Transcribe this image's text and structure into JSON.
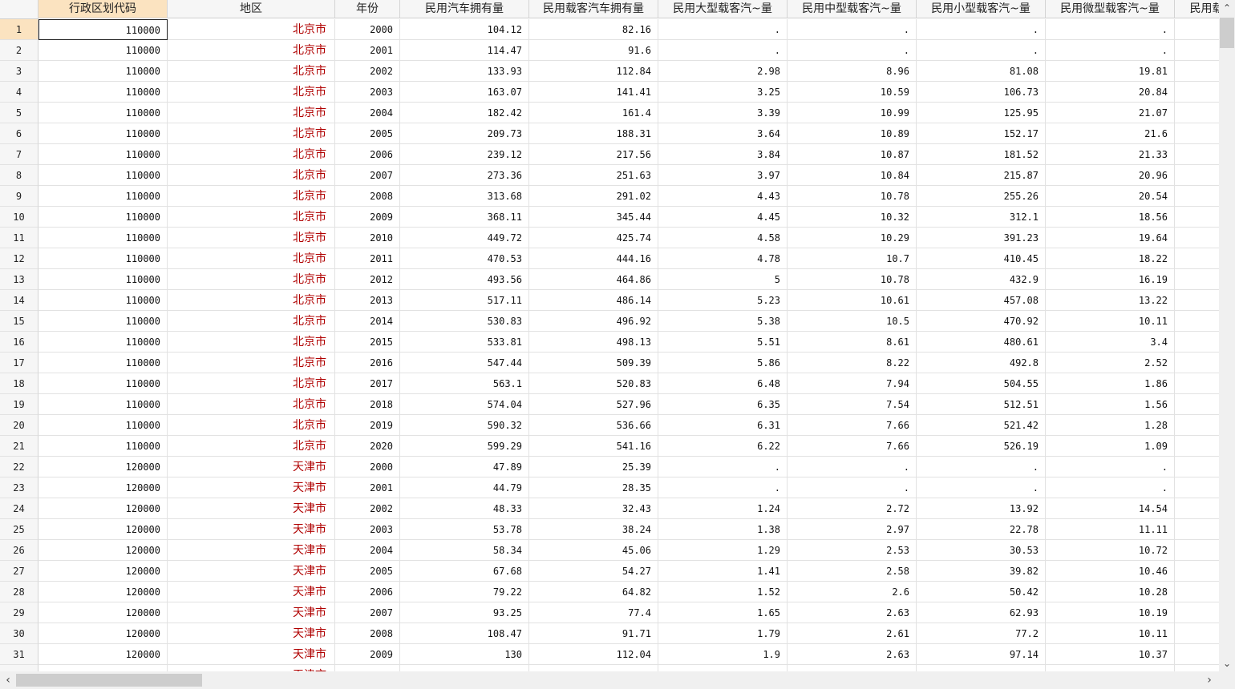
{
  "columns": [
    {
      "label": "行政区划代码",
      "selected": true
    },
    {
      "label": "地区"
    },
    {
      "label": "年份"
    },
    {
      "label": "民用汽车拥有量"
    },
    {
      "label": "民用载客汽车拥有量"
    },
    {
      "label": "民用大型载客汽~量"
    },
    {
      "label": "民用中型载客汽~量"
    },
    {
      "label": "民用小型载客汽~量"
    },
    {
      "label": "民用微型载客汽~量"
    },
    {
      "label": "民用载"
    }
  ],
  "rows": [
    [
      "1",
      "110000",
      "北京市",
      "2000",
      "104.12",
      "82.16",
      ".",
      ".",
      ".",
      ".",
      ""
    ],
    [
      "2",
      "110000",
      "北京市",
      "2001",
      "114.47",
      "91.6",
      ".",
      ".",
      ".",
      ".",
      ""
    ],
    [
      "3",
      "110000",
      "北京市",
      "2002",
      "133.93",
      "112.84",
      "2.98",
      "8.96",
      "81.08",
      "19.81",
      ""
    ],
    [
      "4",
      "110000",
      "北京市",
      "2003",
      "163.07",
      "141.41",
      "3.25",
      "10.59",
      "106.73",
      "20.84",
      ""
    ],
    [
      "5",
      "110000",
      "北京市",
      "2004",
      "182.42",
      "161.4",
      "3.39",
      "10.99",
      "125.95",
      "21.07",
      ""
    ],
    [
      "6",
      "110000",
      "北京市",
      "2005",
      "209.73",
      "188.31",
      "3.64",
      "10.89",
      "152.17",
      "21.6",
      ""
    ],
    [
      "7",
      "110000",
      "北京市",
      "2006",
      "239.12",
      "217.56",
      "3.84",
      "10.87",
      "181.52",
      "21.33",
      ""
    ],
    [
      "8",
      "110000",
      "北京市",
      "2007",
      "273.36",
      "251.63",
      "3.97",
      "10.84",
      "215.87",
      "20.96",
      ""
    ],
    [
      "9",
      "110000",
      "北京市",
      "2008",
      "313.68",
      "291.02",
      "4.43",
      "10.78",
      "255.26",
      "20.54",
      ""
    ],
    [
      "10",
      "110000",
      "北京市",
      "2009",
      "368.11",
      "345.44",
      "4.45",
      "10.32",
      "312.1",
      "18.56",
      ""
    ],
    [
      "11",
      "110000",
      "北京市",
      "2010",
      "449.72",
      "425.74",
      "4.58",
      "10.29",
      "391.23",
      "19.64",
      ""
    ],
    [
      "12",
      "110000",
      "北京市",
      "2011",
      "470.53",
      "444.16",
      "4.78",
      "10.7",
      "410.45",
      "18.22",
      ""
    ],
    [
      "13",
      "110000",
      "北京市",
      "2012",
      "493.56",
      "464.86",
      "5",
      "10.78",
      "432.9",
      "16.19",
      ""
    ],
    [
      "14",
      "110000",
      "北京市",
      "2013",
      "517.11",
      "486.14",
      "5.23",
      "10.61",
      "457.08",
      "13.22",
      ""
    ],
    [
      "15",
      "110000",
      "北京市",
      "2014",
      "530.83",
      "496.92",
      "5.38",
      "10.5",
      "470.92",
      "10.11",
      ""
    ],
    [
      "16",
      "110000",
      "北京市",
      "2015",
      "533.81",
      "498.13",
      "5.51",
      "8.61",
      "480.61",
      "3.4",
      ""
    ],
    [
      "17",
      "110000",
      "北京市",
      "2016",
      "547.44",
      "509.39",
      "5.86",
      "8.22",
      "492.8",
      "2.52",
      ""
    ],
    [
      "18",
      "110000",
      "北京市",
      "2017",
      "563.1",
      "520.83",
      "6.48",
      "7.94",
      "504.55",
      "1.86",
      ""
    ],
    [
      "19",
      "110000",
      "北京市",
      "2018",
      "574.04",
      "527.96",
      "6.35",
      "7.54",
      "512.51",
      "1.56",
      ""
    ],
    [
      "20",
      "110000",
      "北京市",
      "2019",
      "590.32",
      "536.66",
      "6.31",
      "7.66",
      "521.42",
      "1.28",
      ""
    ],
    [
      "21",
      "110000",
      "北京市",
      "2020",
      "599.29",
      "541.16",
      "6.22",
      "7.66",
      "526.19",
      "1.09",
      ""
    ],
    [
      "22",
      "120000",
      "天津市",
      "2000",
      "47.89",
      "25.39",
      ".",
      ".",
      ".",
      ".",
      ""
    ],
    [
      "23",
      "120000",
      "天津市",
      "2001",
      "44.79",
      "28.35",
      ".",
      ".",
      ".",
      ".",
      ""
    ],
    [
      "24",
      "120000",
      "天津市",
      "2002",
      "48.33",
      "32.43",
      "1.24",
      "2.72",
      "13.92",
      "14.54",
      ""
    ],
    [
      "25",
      "120000",
      "天津市",
      "2003",
      "53.78",
      "38.24",
      "1.38",
      "2.97",
      "22.78",
      "11.11",
      ""
    ],
    [
      "26",
      "120000",
      "天津市",
      "2004",
      "58.34",
      "45.06",
      "1.29",
      "2.53",
      "30.53",
      "10.72",
      ""
    ],
    [
      "27",
      "120000",
      "天津市",
      "2005",
      "67.68",
      "54.27",
      "1.41",
      "2.58",
      "39.82",
      "10.46",
      ""
    ],
    [
      "28",
      "120000",
      "天津市",
      "2006",
      "79.22",
      "64.82",
      "1.52",
      "2.6",
      "50.42",
      "10.28",
      ""
    ],
    [
      "29",
      "120000",
      "天津市",
      "2007",
      "93.25",
      "77.4",
      "1.65",
      "2.63",
      "62.93",
      "10.19",
      ""
    ],
    [
      "30",
      "120000",
      "天津市",
      "2008",
      "108.47",
      "91.71",
      "1.79",
      "2.61",
      "77.2",
      "10.11",
      ""
    ],
    [
      "31",
      "120000",
      "天津市",
      "2009",
      "130",
      "112.04",
      "1.9",
      "2.63",
      "97.14",
      "10.37",
      ""
    ]
  ],
  "partial_row_region": "天津市",
  "scroll": {
    "up_arrow": "⌃",
    "down_arrow": "⌄",
    "left_arrow": "‹",
    "right_arrow": "›"
  }
}
